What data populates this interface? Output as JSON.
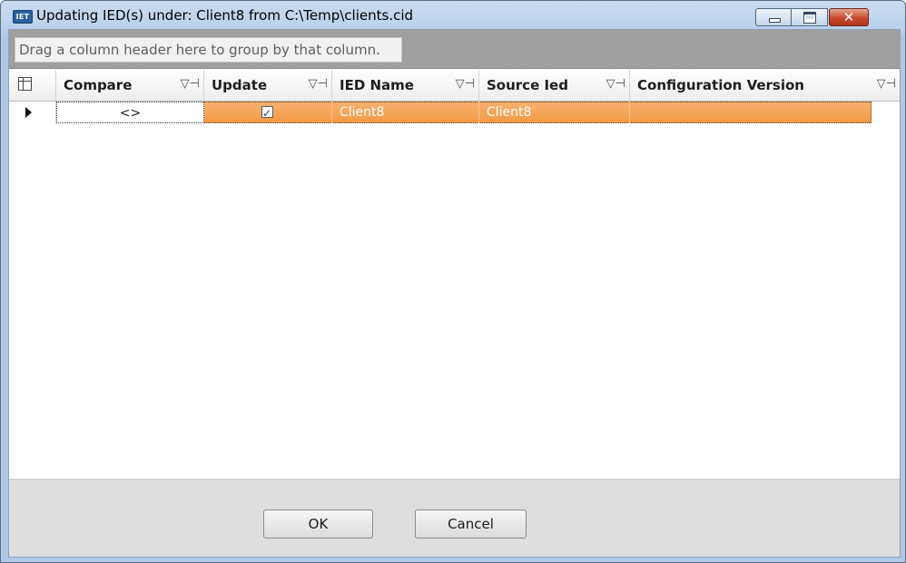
{
  "window": {
    "icon_text": "IET",
    "title": "Updating IED(s) under: Client8 from C:\\Temp\\clients.cid",
    "close_glyph": "✕"
  },
  "group_panel": {
    "hint": "Drag a column header here to group by that column."
  },
  "grid": {
    "columns": [
      {
        "label": "Compare",
        "icons": "▽⊣"
      },
      {
        "label": "Update",
        "icons": "▽⊣"
      },
      {
        "label": "IED Name",
        "icons": "▽⊣"
      },
      {
        "label": "Source Ied",
        "icons": "▽⊣"
      },
      {
        "label": "Configuration Version",
        "icons": "▽⊣"
      }
    ],
    "rows": [
      {
        "compare": "<>",
        "update_checked": true,
        "checkmark": "✓",
        "ied_name": "Client8",
        "source_ied": "Client8",
        "configuration_version": ""
      }
    ]
  },
  "buttons": {
    "ok": "OK",
    "cancel": "Cancel"
  },
  "colors": {
    "selected_row": "#f39a45",
    "group_panel": "#9f9f9f",
    "title_close": "#c84a2c"
  }
}
